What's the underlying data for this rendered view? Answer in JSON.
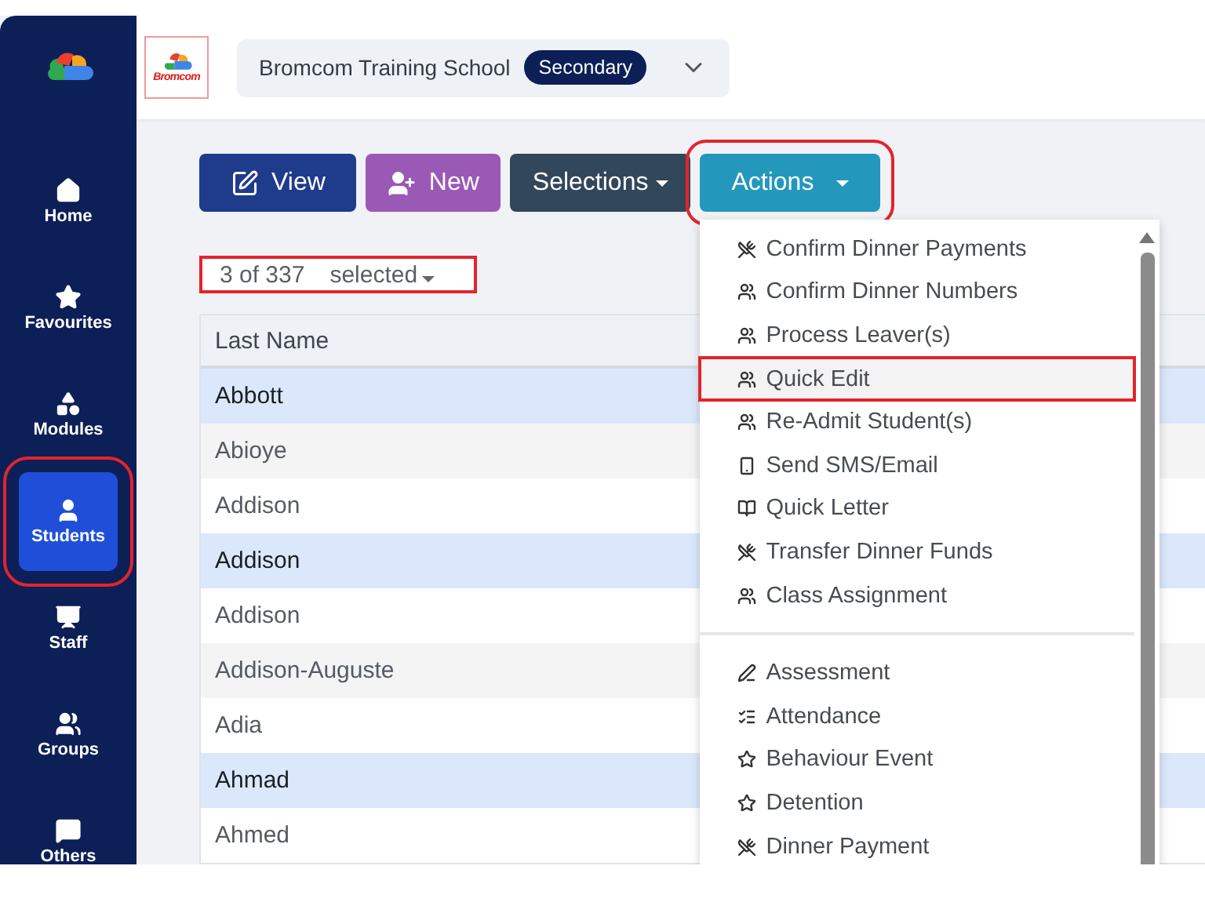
{
  "sidebar": {
    "items": [
      {
        "kind": "home",
        "label": "Home",
        "selected": false,
        "highlighted": false
      },
      {
        "kind": "favourites",
        "label": "Favourites",
        "selected": false,
        "highlighted": false
      },
      {
        "kind": "modules",
        "label": "Modules",
        "selected": false,
        "highlighted": false
      },
      {
        "kind": "students",
        "label": "Students",
        "selected": true,
        "highlighted": true
      },
      {
        "kind": "staff",
        "label": "Staff",
        "selected": false,
        "highlighted": false
      },
      {
        "kind": "groups",
        "label": "Groups",
        "selected": false,
        "highlighted": false
      },
      {
        "kind": "others",
        "label": "Others",
        "selected": false,
        "highlighted": false
      }
    ]
  },
  "header": {
    "logo_text": "Bromcom",
    "school": "Bromcom Training School",
    "phase": "Secondary"
  },
  "toolbar": {
    "buttons": [
      {
        "kind": "view",
        "label": "View",
        "highlighted": false
      },
      {
        "kind": "new",
        "label": "New",
        "highlighted": false
      },
      {
        "kind": "selections",
        "label": "Selections",
        "highlighted": false
      },
      {
        "kind": "actions",
        "label": "Actions",
        "highlighted": true
      }
    ]
  },
  "selection": {
    "count": "3 of 337",
    "label": "selected",
    "highlighted": true
  },
  "table": {
    "columns": [
      "Last Name"
    ],
    "rows": [
      {
        "last_name": "Abbott",
        "selected": true
      },
      {
        "last_name": "Abioye",
        "selected": false
      },
      {
        "last_name": "Addison",
        "selected": false
      },
      {
        "last_name": "Addison",
        "selected": true
      },
      {
        "last_name": "Addison",
        "selected": false
      },
      {
        "last_name": "Addison-Auguste",
        "selected": false
      },
      {
        "last_name": "Adia",
        "selected": false
      },
      {
        "last_name": "Ahmad",
        "selected": true
      },
      {
        "last_name": "Ahmed",
        "selected": false
      }
    ]
  },
  "action_menu": {
    "sections": [
      {
        "items": [
          {
            "kind": "dinner",
            "label": "Confirm Dinner Payments",
            "hovered": false,
            "highlighted": false
          },
          {
            "kind": "people",
            "label": "Confirm Dinner Numbers",
            "hovered": false,
            "highlighted": false
          },
          {
            "kind": "people",
            "label": "Process Leaver(s)",
            "hovered": false,
            "highlighted": false
          },
          {
            "kind": "people",
            "label": "Quick Edit",
            "hovered": true,
            "highlighted": true
          },
          {
            "kind": "people",
            "label": "Re-Admit Student(s)",
            "hovered": false,
            "highlighted": false
          },
          {
            "kind": "phone",
            "label": "Send SMS/Email",
            "hovered": false,
            "highlighted": false
          },
          {
            "kind": "letter",
            "label": "Quick Letter",
            "hovered": false,
            "highlighted": false
          },
          {
            "kind": "dinner",
            "label": "Transfer Dinner Funds",
            "hovered": false,
            "highlighted": false
          },
          {
            "kind": "people",
            "label": "Class Assignment",
            "hovered": false,
            "highlighted": false
          }
        ]
      },
      {
        "items": [
          {
            "kind": "assessment",
            "label": "Assessment",
            "hovered": false,
            "highlighted": false
          },
          {
            "kind": "attendance",
            "label": "Attendance",
            "hovered": false,
            "highlighted": false
          },
          {
            "kind": "behaviour",
            "label": "Behaviour Event",
            "hovered": false,
            "highlighted": false
          },
          {
            "kind": "behaviour",
            "label": "Detention",
            "hovered": false,
            "highlighted": false
          },
          {
            "kind": "dinner",
            "label": "Dinner Payment",
            "hovered": false,
            "highlighted": false
          }
        ]
      }
    ]
  }
}
